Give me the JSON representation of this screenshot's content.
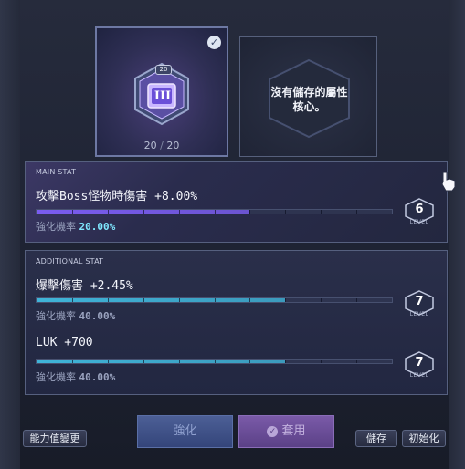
{
  "core": {
    "level_badge": "20",
    "numeral": "III",
    "count_current": "20",
    "count_sep": "/",
    "count_max": "20",
    "selected_icon": "check-icon"
  },
  "empty_slot": {
    "message": "沒有儲存的屬性核心。"
  },
  "main_stat": {
    "section_title": "MAIN STAT",
    "label": "攻擊Boss怪物時傷害 +8.00%",
    "rate_label": "強化機率",
    "rate_value": "20.00%",
    "level": "6",
    "level_caption": "LEVEL",
    "progress": 0.6,
    "bar_color": "#7a5cf0"
  },
  "additional_stat": {
    "section_title": "ADDITIONAL STAT",
    "stats": [
      {
        "label": "爆擊傷害 +2.45%",
        "rate_label": "強化機率",
        "rate_value": "40.00%",
        "level": "7",
        "level_caption": "LEVEL",
        "progress": 0.7
      },
      {
        "label": "LUK +700",
        "rate_label": "強化機率",
        "rate_value": "40.00%",
        "level": "7",
        "level_caption": "LEVEL",
        "progress": 0.7
      }
    ],
    "bar_color": "#3fb4d8"
  },
  "buttons": {
    "stat_change": "能力值變更",
    "enhance": "強化",
    "apply": "套用",
    "save": "儲存",
    "reset": "初始化"
  },
  "colors": {
    "accent_purple": "#7a5cf0",
    "accent_cyan": "#3fb4d8",
    "rate_highlight": "#7fe8ff"
  }
}
